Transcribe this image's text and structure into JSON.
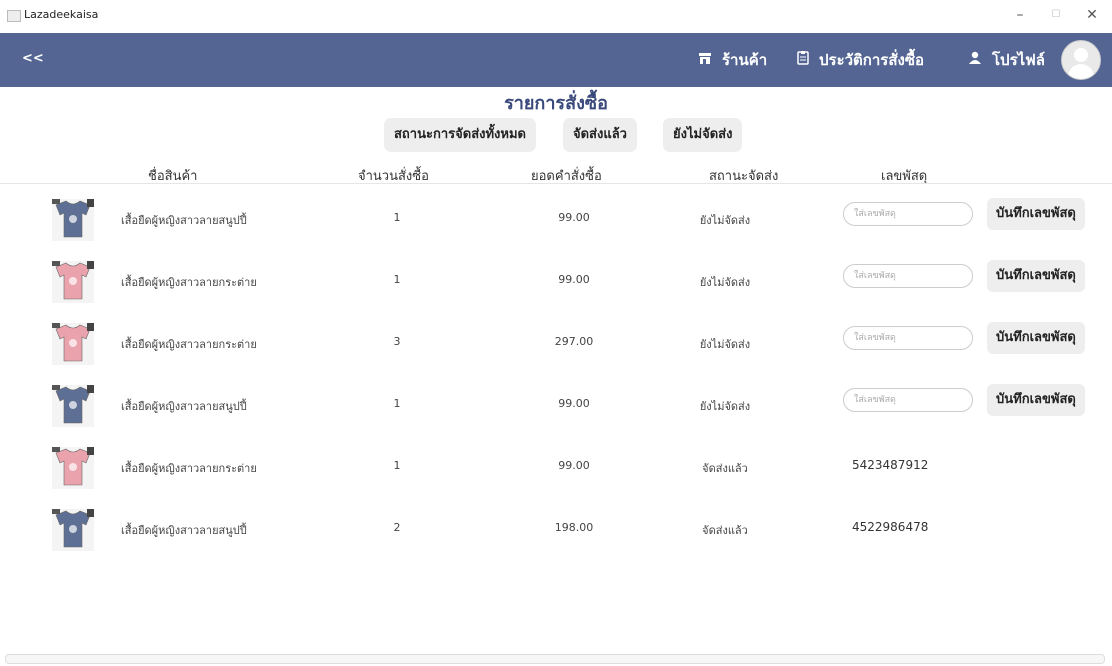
{
  "window": {
    "title": "Lazadeekaisa",
    "minimize": "–",
    "maximize": "☐",
    "close": "✕"
  },
  "nav": {
    "back_glyph": "<<",
    "shop": {
      "label": "ร้านค้า",
      "icon": "shop-icon"
    },
    "history": {
      "label": "ประวัติการสั่งซื้อ",
      "icon": "clipboard-icon"
    },
    "profile": {
      "label": "โปรไฟล์",
      "icon": "user-icon"
    }
  },
  "page": {
    "title": "รายการสั่งซื้อ",
    "filters": [
      "สถานะการจัดส่งทั้งหมด",
      "จัดส่งแล้ว",
      "ยังไม่จัดส่ง"
    ],
    "columns": [
      "ชื่อสินค้า",
      "จำนวนสั่งซื้อ",
      "ยอดคำสั่งซื้อ",
      "สถานะจัดส่ง",
      "เลขพัสดุ"
    ],
    "tracking_placeholder": "ใส่เลขพัสดุ",
    "save_label": "บันทึกเลขพัสดุ"
  },
  "orders": [
    {
      "name": "เสื้อยืดผู้หญิงสาวลายสนูปปี้",
      "qty": "1",
      "total": "99.00",
      "status": "ยังไม่จัดส่ง",
      "tracking": "",
      "shirt_color": "#5d6f95"
    },
    {
      "name": "เสื้อยืดผู้หญิงสาวลายกระต่าย",
      "qty": "1",
      "total": "99.00",
      "status": "ยังไม่จัดส่ง",
      "tracking": "",
      "shirt_color": "#eaa2ad"
    },
    {
      "name": "เสื้อยืดผู้หญิงสาวลายกระต่าย",
      "qty": "3",
      "total": "297.00",
      "status": "ยังไม่จัดส่ง",
      "tracking": "",
      "shirt_color": "#eaa2ad"
    },
    {
      "name": "เสื้อยืดผู้หญิงสาวลายสนูปปี้",
      "qty": "1",
      "total": "99.00",
      "status": "ยังไม่จัดส่ง",
      "tracking": "",
      "shirt_color": "#5d6f95"
    },
    {
      "name": "เสื้อยืดผู้หญิงสาวลายกระต่าย",
      "qty": "1",
      "total": "99.00",
      "status": "จัดส่งแล้ว",
      "tracking": "5423487912",
      "shirt_color": "#eaa2ad"
    },
    {
      "name": "เสื้อยืดผู้หญิงสาวลายสนูปปี้",
      "qty": "2",
      "total": "198.00",
      "status": "จัดส่งแล้ว",
      "tracking": "4522986478",
      "shirt_color": "#5d6f95"
    }
  ],
  "colors": {
    "navbar": "#546594",
    "title": "#3b4a7c",
    "button_bg": "#eeeeee"
  }
}
